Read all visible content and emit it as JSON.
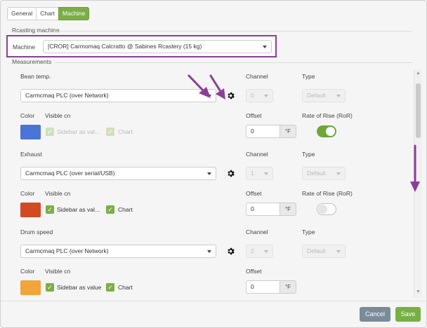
{
  "tabs": [
    "General",
    "Chart",
    "Machine"
  ],
  "active_tab": "Machine",
  "roasting_section": "Rcasting machine",
  "machine": {
    "label": "Machine",
    "value": "[CROR] Carmomaq Calcratto @ Sabines Rcastery (15 kg)"
  },
  "measurements_section": "Measurements",
  "headers": {
    "channel": "Channel",
    "type": "Type",
    "color": "Color",
    "visible_on": "Visible cn",
    "offset": "Offset",
    "ror": "Rate of Rise (RoR)"
  },
  "rows": [
    {
      "name": "Bean temp.",
      "source": "Carmcmaq PLC (over Network)",
      "channel": "0",
      "type": "Default",
      "color": "#4a74d6",
      "sidebar_label": "Sidebar as val...",
      "chart_label": "Chart",
      "checks_enabled": false,
      "offset": "0",
      "unit": "°F",
      "ror_on": true
    },
    {
      "name": "Exhaust",
      "source": "Carmcmaq PLC (over serial/USB)",
      "channel": "1",
      "type": "Default",
      "color": "#d24a22",
      "sidebar_label": "Sidebar as val...",
      "chart_label": "Chart",
      "checks_enabled": true,
      "offset": "0",
      "unit": "°F",
      "ror_on": false
    },
    {
      "name": "Drum speed",
      "source": "Carmcmaq PLC (over Network)",
      "channel": "2",
      "type": "Default",
      "color": "#f0a43a",
      "sidebar_label": "Sidebar as value",
      "chart_label": "Chart",
      "checks_enabled": true,
      "offset": "0",
      "unit": "°F"
    }
  ],
  "buttons": {
    "cancel": "Cancel",
    "save": "Save"
  },
  "annotation_color": "#8a3e96"
}
